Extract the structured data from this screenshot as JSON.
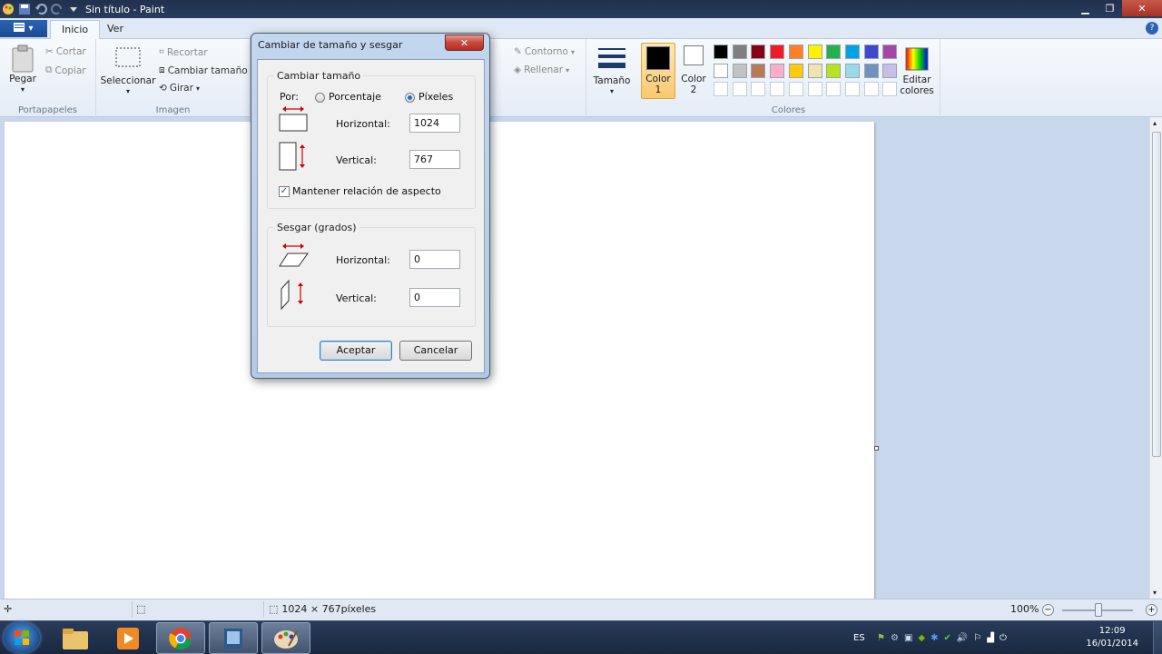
{
  "window": {
    "title": "Sin título - Paint"
  },
  "tabs": {
    "file": "",
    "home": "Inicio",
    "view": "Ver"
  },
  "ribbon": {
    "clipboard": {
      "paste": "Pegar",
      "cut": "Cortar",
      "copy": "Copiar",
      "group": "Portapapeles"
    },
    "image": {
      "select": "Seleccionar",
      "crop": "Recortar",
      "resize": "Cambiar tamaño",
      "rotate": "Girar",
      "group": "Imagen"
    },
    "shapes": {
      "outline": "Contorno",
      "fill": "Rellenar"
    },
    "size": "Tamaño",
    "colors": {
      "color1_top": "Color",
      "color1_num": "1",
      "color2_top": "Color",
      "color2_num": "2",
      "edit_top": "Editar",
      "edit_bottom": "colores",
      "group": "Colores",
      "row1": [
        "#000000",
        "#7f7f7f",
        "#880015",
        "#ed1c24",
        "#ff7f27",
        "#fff200",
        "#22b14c",
        "#00a2e8",
        "#3f48cc",
        "#a349a4"
      ],
      "row2": [
        "#ffffff",
        "#c3c3c3",
        "#b97a57",
        "#ffaec9",
        "#ffc90e",
        "#efe4b0",
        "#b5e61d",
        "#99d9ea",
        "#7092be",
        "#c8bfe7"
      ],
      "row3": [
        "#ffffff",
        "#ffffff",
        "#ffffff",
        "#ffffff",
        "#ffffff",
        "#ffffff",
        "#ffffff",
        "#ffffff",
        "#ffffff",
        "#ffffff"
      ],
      "primary": "#000000",
      "secondary": "#ffffff"
    }
  },
  "dialog": {
    "title": "Cambiar de tamaño y sesgar",
    "resize": {
      "legend": "Cambiar tamaño",
      "by_label": "Por:",
      "percent_label": "Porcentaje",
      "pixels_label": "Píxeles",
      "horizontal_label": "Horizontal:",
      "horizontal_value": "1024",
      "vertical_label": "Vertical:",
      "vertical_value": "767",
      "keep_aspect_label": "Mantener relación de aspecto"
    },
    "skew": {
      "legend": "Sesgar (grados)",
      "horizontal_label": "Horizontal:",
      "horizontal_value": "0",
      "vertical_label": "Vertical:",
      "vertical_value": "0"
    },
    "ok": "Aceptar",
    "cancel": "Cancelar"
  },
  "statusbar": {
    "dimensions": "1024 × 767píxeles",
    "zoom": "100%"
  },
  "taskbar": {
    "language": "ES",
    "time": "12:09",
    "date": "16/01/2014"
  }
}
